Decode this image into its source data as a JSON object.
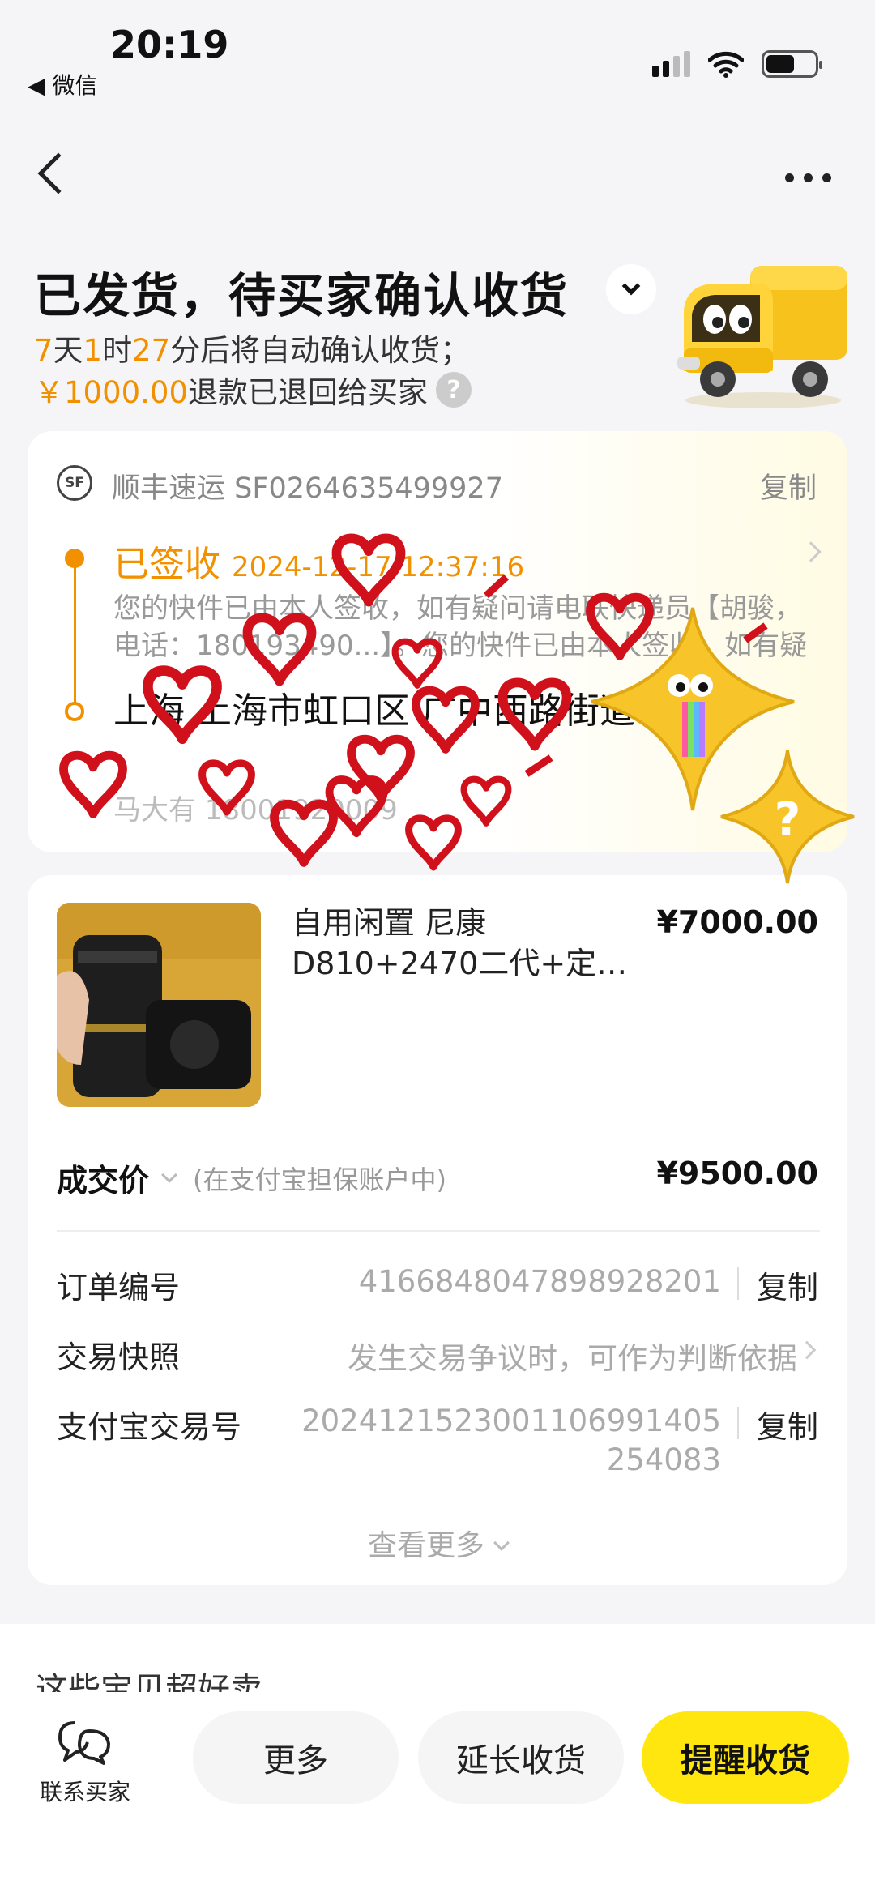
{
  "status_bar": {
    "time": "20:19",
    "back_app": "◀ 微信"
  },
  "header": {
    "title": "已发货，待买家确认收货",
    "countdown": {
      "days": "7",
      "days_unit": "天",
      "hours": "1",
      "hours_unit": "时",
      "minutes": "27",
      "minutes_unit": "分后将自动确认收货；"
    },
    "refund_amount": "￥1000.00",
    "refund_text": "退款已退回给买家",
    "help_icon": "?"
  },
  "logistics": {
    "carrier_logo": "SF",
    "carrier": "顺丰速运 SF0264635499927",
    "copy_label": "复制",
    "status": "已签收",
    "status_time": "2024-12-17 12:37:16",
    "description": "您的快件已由本人签收，如有疑问请电联快递员【胡骏，电话：180193490...】。您的快件已由本人签收，如有疑问...",
    "address": "上海 上海市虹口区 广中西路街道 258弄",
    "contact": "马大有 18001920009"
  },
  "product": {
    "name": "自用闲置 尼康D810+2470二代+定…",
    "price": "¥7000.00",
    "deal_label": "成交价",
    "deal_note": "(在支付宝担保账户中)",
    "deal_price": "¥9500.00"
  },
  "order": {
    "order_no_label": "订单编号",
    "order_no": "4166848047898928201",
    "snapshot_label": "交易快照",
    "snapshot_text": "发生交易争议时，可作为判断依据",
    "alipay_label": "支付宝交易号",
    "alipay_no_1": "202412152300110699140​5",
    "alipay_no_2": "254083",
    "copy_label": "复制",
    "see_more": "查看更多"
  },
  "recommend": {
    "title": "这些宝贝超好卖"
  },
  "actions": {
    "contact_buyer": "联系买家",
    "more": "更多",
    "extend": "延长收货",
    "remind": "提醒收货"
  },
  "colors": {
    "accent_orange": "#f29100",
    "primary_yellow": "#ffe60f",
    "sticker_red": "#d0101b"
  }
}
